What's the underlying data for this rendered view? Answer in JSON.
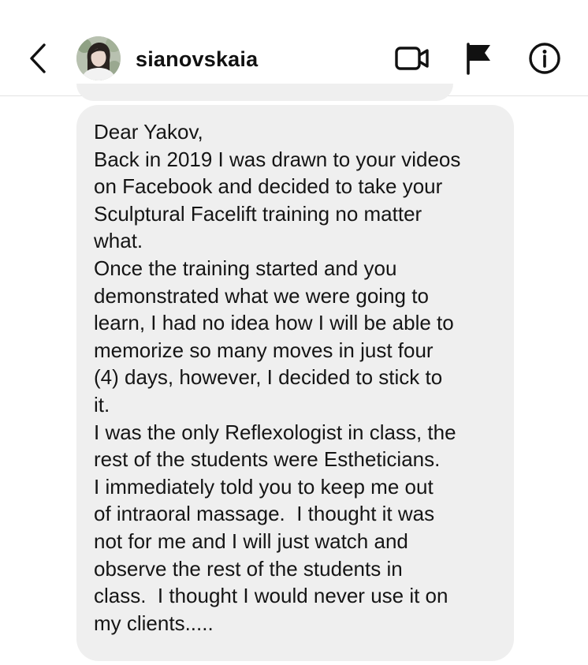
{
  "header": {
    "username": "sianovskaia",
    "icons": {
      "back": "chevron-left-icon",
      "avatar": "profile-photo",
      "video": "video-camera-icon",
      "flag": "flag-icon",
      "info": "info-icon"
    }
  },
  "message": {
    "lines": [
      "Dear Yakov,",
      "Back in 2019 I was drawn to your videos",
      "on Facebook and decided to take your",
      "Sculptural Facelift training no matter",
      "what.",
      "Once the training started and you",
      "demonstrated what we were going to",
      "learn, I had no idea how I will be able to",
      "memorize so many moves in just four",
      "(4) days, however, I decided to stick to",
      "it.",
      "I was the only Reflexologist in class, the",
      "rest of the students were Estheticians.",
      "I immediately told you to keep me out",
      "of intraoral massage.  I thought it was",
      "not for me and I will just watch and",
      "observe the rest of the students in",
      "class.  I thought I would never use it on",
      "my clients....."
    ]
  },
  "colors": {
    "bubble": "#efefef",
    "text": "#151515",
    "background": "#ffffff"
  }
}
